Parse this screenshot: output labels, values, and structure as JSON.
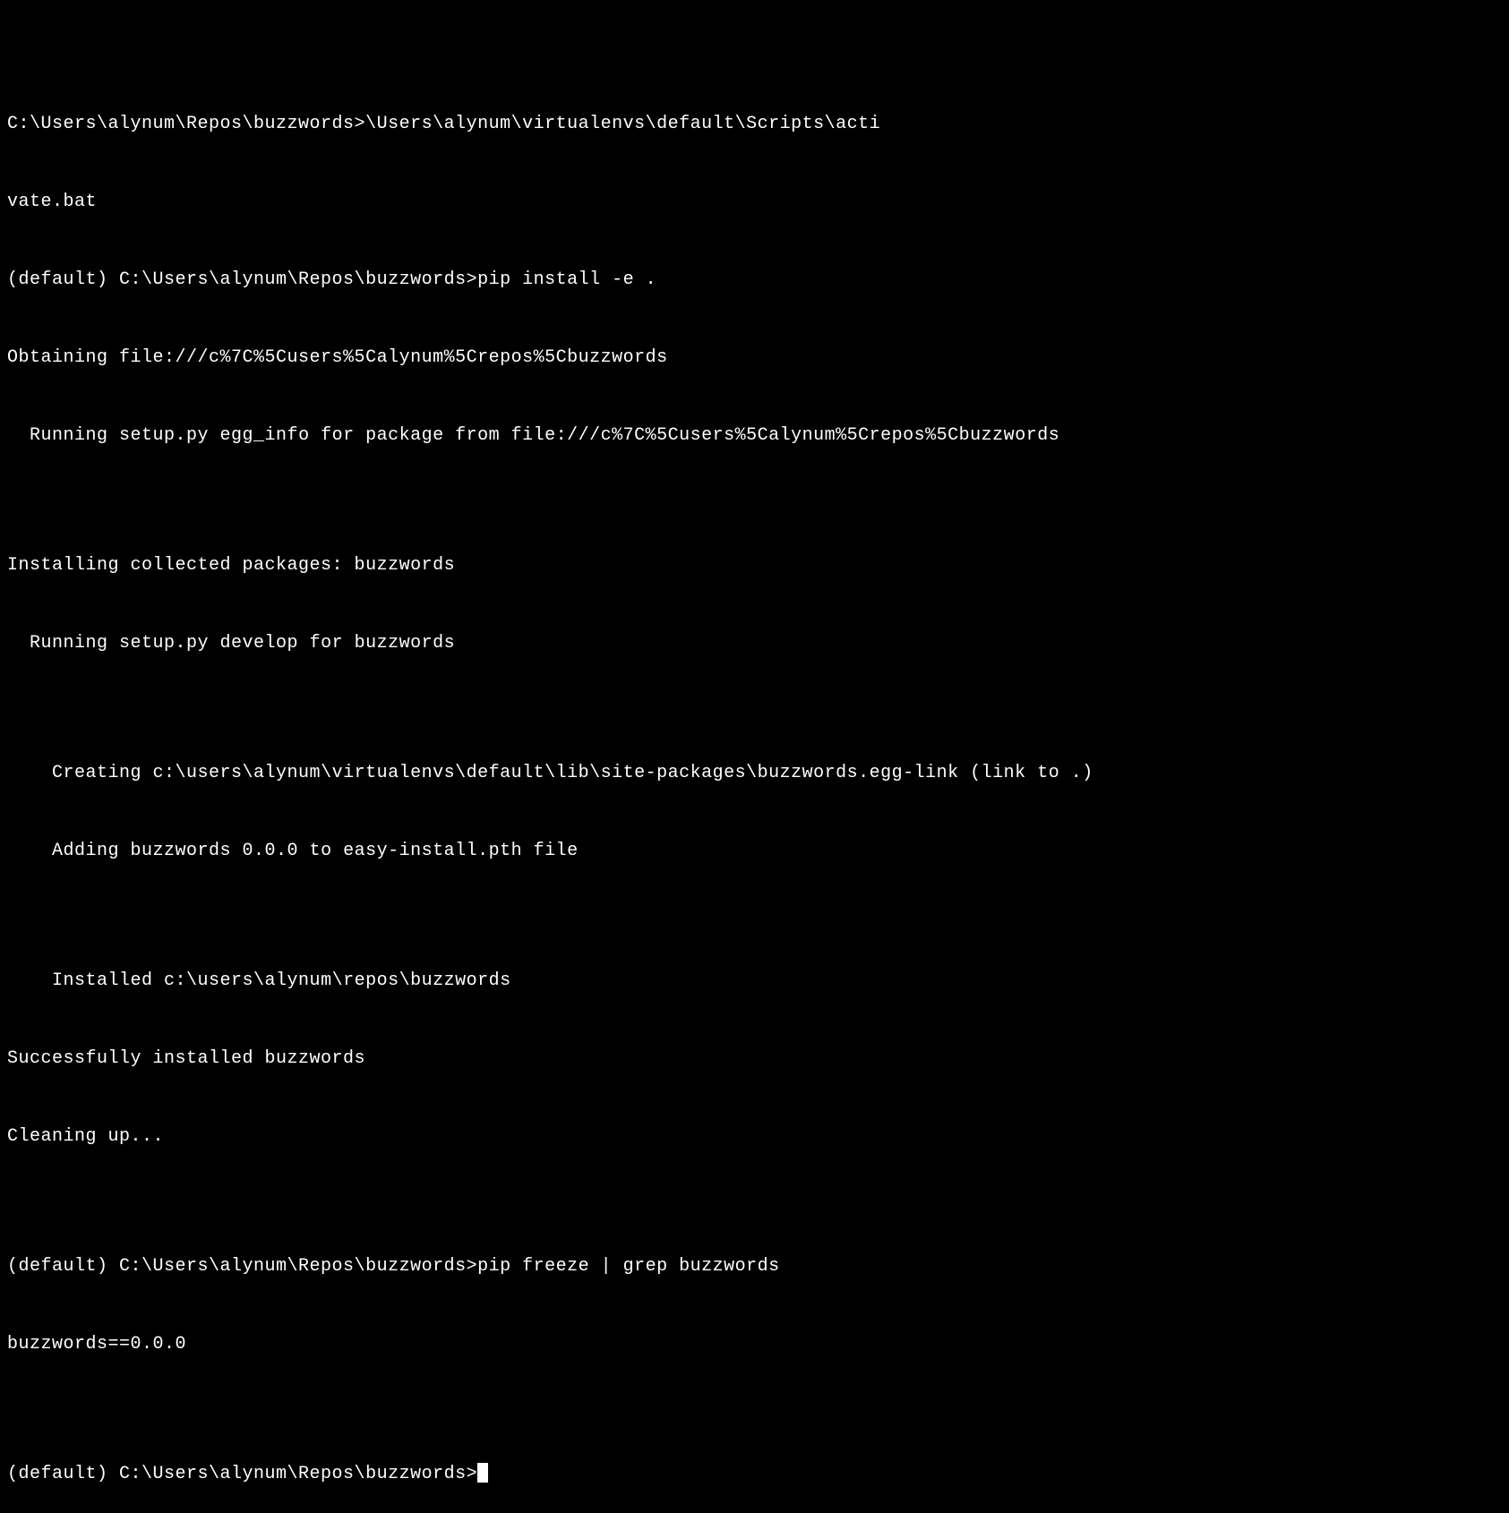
{
  "terminal": {
    "lines": [
      "",
      "C:\\Users\\alynum\\Repos\\buzzwords>\\Users\\alynum\\virtualenvs\\default\\Scripts\\acti",
      "vate.bat",
      "(default) C:\\Users\\alynum\\Repos\\buzzwords>pip install -e .",
      "Obtaining file:///c%7C%5Cusers%5Calynum%5Crepos%5Cbuzzwords",
      "  Running setup.py egg_info for package from file:///c%7C%5Cusers%5Calynum%5Crepos%5Cbuzzwords",
      "",
      "Installing collected packages: buzzwords",
      "  Running setup.py develop for buzzwords",
      "",
      "    Creating c:\\users\\alynum\\virtualenvs\\default\\lib\\site-packages\\buzzwords.egg-link (link to .)",
      "    Adding buzzwords 0.0.0 to easy-install.pth file",
      "",
      "    Installed c:\\users\\alynum\\repos\\buzzwords",
      "Successfully installed buzzwords",
      "Cleaning up...",
      "",
      "(default) C:\\Users\\alynum\\Repos\\buzzwords>pip freeze | grep buzzwords",
      "buzzwords==0.0.0",
      "",
      "(default) C:\\Users\\alynum\\Repos\\buzzwords>"
    ],
    "prompt_final": "(default) C:\\Users\\alynum\\Repos\\buzzwords>"
  }
}
